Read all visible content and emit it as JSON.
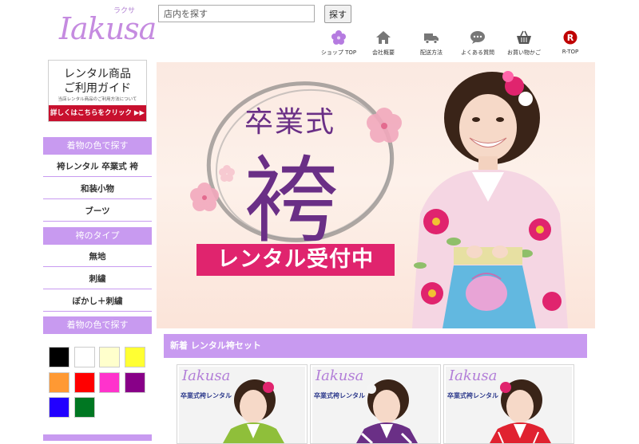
{
  "header": {
    "logo_text": "Iakusa",
    "logo_kana": "ラクサ",
    "search": {
      "placeholder": "店内を探す",
      "button_label": "探す"
    },
    "nav": [
      {
        "label": "ショップ TOP",
        "icon": "flower-icon"
      },
      {
        "label": "会社概要",
        "icon": "home-icon"
      },
      {
        "label": "配送方法",
        "icon": "truck-icon"
      },
      {
        "label": "よくある質問",
        "icon": "chat-bubble-icon"
      },
      {
        "label": "お買い物かご",
        "icon": "basket-icon"
      },
      {
        "label": "R-TOP",
        "icon": "rakuten-r-icon"
      }
    ]
  },
  "sidebar": {
    "guide": {
      "title_line1": "レンタル商品",
      "title_line2": "ご利用ガイド",
      "subtitle": "当店レンタル商品のご利用方法について",
      "cta": "詳しくはこちらをクリック ▶▶"
    },
    "section1": {
      "heading": "着物の色で探す",
      "items": [
        "袴レンタル 卒業式 袴",
        "和装小物",
        "ブーツ"
      ]
    },
    "section2": {
      "heading": "袴のタイプ",
      "items": [
        "無地",
        "刺繍",
        "ぼかし＋刺繍"
      ]
    },
    "section3": {
      "heading": "着物の色で探す",
      "swatches": [
        "#000000",
        "#ffffff",
        "#ffffcc",
        "#ffff33",
        "#ff9933",
        "#ff0000",
        "#ff33cc",
        "#880088",
        "#2200ff",
        "#007722"
      ]
    }
  },
  "hero": {
    "line1": "卒業式",
    "line2": "袴",
    "badge": "レンタル受付中"
  },
  "new_arrivals": {
    "heading": "新着 レンタル袴セット",
    "cards": [
      {
        "brand": "Iakusa",
        "title": "卒業式袴レンタル"
      },
      {
        "brand": "Iakusa",
        "title": "卒業式袴レンタル"
      },
      {
        "brand": "Iakusa",
        "title": "卒業式袴レンタル"
      }
    ]
  },
  "colors": {
    "accent_purple": "#c89af0",
    "cta_red": "#c8102e",
    "badge_pink": "#e0246e",
    "hero_text_purple": "#6a2f86"
  }
}
